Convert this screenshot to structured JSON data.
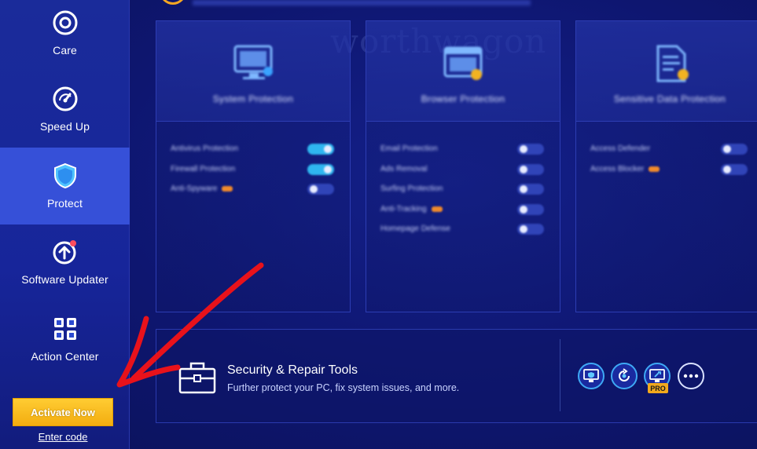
{
  "sidebar": {
    "items": [
      {
        "label": "Care",
        "icon": "care-icon",
        "active": false
      },
      {
        "label": "Speed Up",
        "icon": "speedometer-icon",
        "active": false
      },
      {
        "label": "Protect",
        "icon": "shield-icon",
        "active": true
      },
      {
        "label": "Software Updater",
        "icon": "update-arrow-icon",
        "active": false
      },
      {
        "label": "Action Center",
        "icon": "grid-apps-icon",
        "active": false
      }
    ],
    "activate_label": "Activate Now",
    "enter_code_label": "Enter code"
  },
  "watermark": "worthwagon",
  "cards": [
    {
      "title": "System Protection",
      "icon": "monitor-icon",
      "rows": [
        {
          "label": "Antivirus Protection",
          "toggle": "on",
          "badge": false
        },
        {
          "label": "Firewall Protection",
          "toggle": "on",
          "badge": false
        },
        {
          "label": "Anti-Spyware",
          "toggle": "off",
          "badge": true
        }
      ]
    },
    {
      "title": "Browser Protection",
      "icon": "browser-window-icon",
      "rows": [
        {
          "label": "Email Protection",
          "toggle": "off",
          "badge": false
        },
        {
          "label": "Ads Removal",
          "toggle": "off",
          "badge": false
        },
        {
          "label": "Surfing Protection",
          "toggle": "off",
          "badge": false
        },
        {
          "label": "Anti-Tracking",
          "toggle": "off",
          "badge": true
        },
        {
          "label": "Homepage Defense",
          "toggle": "off",
          "badge": false
        }
      ]
    },
    {
      "title": "Sensitive Data Protection",
      "icon": "document-icon",
      "rows": [
        {
          "label": "Access Defender",
          "toggle": "off",
          "badge": false
        },
        {
          "label": "Access Blocker",
          "toggle": "off",
          "badge": true
        }
      ]
    }
  ],
  "tools": {
    "title": "Security & Repair Tools",
    "subtitle": "Further protect your PC, fix system issues, and more.",
    "buttons": [
      "monitor-shield-icon",
      "refresh-tool-icon",
      "screen-repair-icon",
      "more-icon"
    ],
    "pro_badge": "PRO"
  },
  "colors": {
    "accent_active": "#3650d8",
    "activate_button": "#f3ad0f",
    "toggle_on": "#2fb6f0",
    "annotation_arrow": "#e8121b"
  }
}
